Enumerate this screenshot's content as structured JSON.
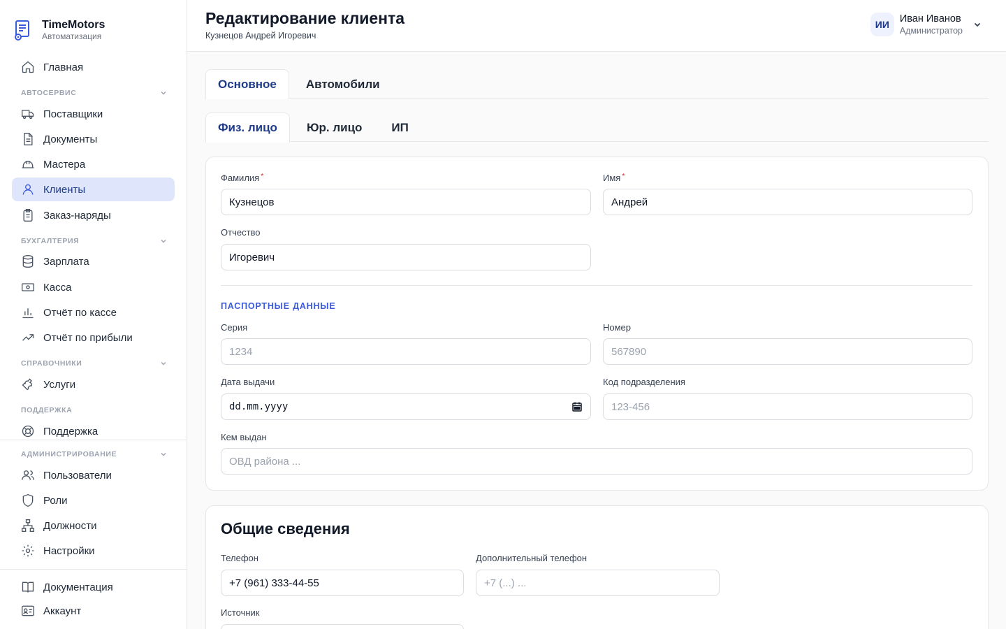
{
  "brand": {
    "name": "TimeMotors",
    "subtitle": "Автоматизация"
  },
  "sidebar": {
    "home": "Главная",
    "sections": {
      "autoservice": "АВТОСЕРВИС",
      "accounting": "БУХГАЛТЕРИЯ",
      "references": "СПРАВОЧНИКИ",
      "support": "ПОДДЕРЖКА",
      "admin": "АДМИНИСТРИРОВАНИЕ"
    },
    "items": {
      "suppliers": "Поставщики",
      "documents": "Документы",
      "masters": "Мастера",
      "clients": "Клиенты",
      "orders": "Заказ-наряды",
      "salary": "Зарплата",
      "cashbox": "Касса",
      "cash_report": "Отчёт по кассе",
      "profit_report": "Отчёт по прибыли",
      "services": "Услуги",
      "support": "Поддержка",
      "users": "Пользователи",
      "roles": "Роли",
      "positions": "Должности",
      "settings": "Настройки",
      "documentation": "Документация",
      "account": "Аккаунт"
    },
    "active": "clients"
  },
  "header": {
    "title": "Редактирование клиента",
    "subtitle": "Кузнецов Андрей Игоревич",
    "user": {
      "initials": "ИИ",
      "name": "Иван Иванов",
      "role": "Администратор"
    }
  },
  "tabs": [
    "Основное",
    "Автомобили"
  ],
  "subtabs": [
    "Физ. лицо",
    "Юр. лицо",
    "ИП"
  ],
  "person": {
    "last_name_label": "Фамилия",
    "last_name": "Кузнецов",
    "first_name_label": "Имя",
    "first_name": "Андрей",
    "middle_name_label": "Отчество",
    "middle_name": "Игоревич",
    "required_mark": "*"
  },
  "passport": {
    "title": "ПАСПОРТНЫЕ ДАННЫЕ",
    "series_label": "Серия",
    "series_placeholder": "1234",
    "number_label": "Номер",
    "number_placeholder": "567890",
    "issue_date_label": "Дата выдачи",
    "issue_date_placeholder": "dd.mm.yyyy",
    "dept_code_label": "Код подразделения",
    "dept_code_placeholder": "123-456",
    "issued_by_label": "Кем выдан",
    "issued_by_placeholder": "ОВД района ..."
  },
  "general": {
    "title": "Общие сведения",
    "phone_label": "Телефон",
    "phone": "+7 (961) 333-44-55",
    "extra_phone_label": "Дополнительный телефон",
    "extra_phone_placeholder": "+7 (...) ...",
    "source_label": "Источник"
  },
  "colors": {
    "accent": "#3b5bdb",
    "active_bg": "#dfe6fb",
    "required": "#dc2626"
  }
}
